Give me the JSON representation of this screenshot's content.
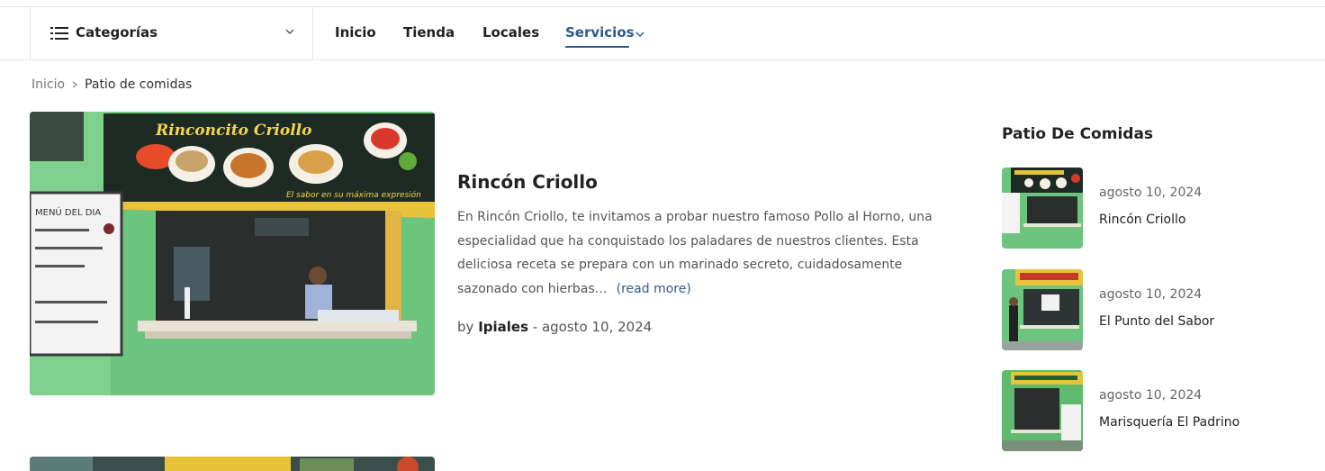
{
  "nav": {
    "categories_label": "Categorías",
    "items": [
      {
        "label": "Inicio"
      },
      {
        "label": "Tienda"
      },
      {
        "label": "Locales"
      },
      {
        "label": "Servicios"
      }
    ]
  },
  "breadcrumb": {
    "home": "Inicio",
    "current": "Patio de comidas"
  },
  "post": {
    "title": "Rincón Criollo",
    "excerpt": "En Rincón Criollo, te invitamos a probar nuestro famoso Pollo al Horno, una especialidad que ha conquistado los paladares de nuestros clientes. Esta deliciosa receta se prepara con un marinado secreto, cuidadosamente sazonado con hierbas…",
    "read_more": "(read more)",
    "meta_by": "by",
    "author": "Ipiales",
    "meta_sep": " - ",
    "date": "agosto 10, 2024",
    "image_sign_text": "Rinconcito Criollo",
    "image_slogan": "El sabor en su máxima expresión",
    "image_menu_text": "MENÚ DEL DIA"
  },
  "sidebar": {
    "title": "Patio De Comidas",
    "items": [
      {
        "date": "agosto 10, 2024",
        "name": "Rincón Criollo"
      },
      {
        "date": "agosto 10, 2024",
        "name": "El Punto del Sabor"
      },
      {
        "date": "agosto 10, 2024",
        "name": "Marisquería El Padrino"
      }
    ]
  },
  "colors": {
    "accent": "#2f5a8c",
    "wall_green": "#6cc47e",
    "sign_dark": "#1e2a24"
  }
}
